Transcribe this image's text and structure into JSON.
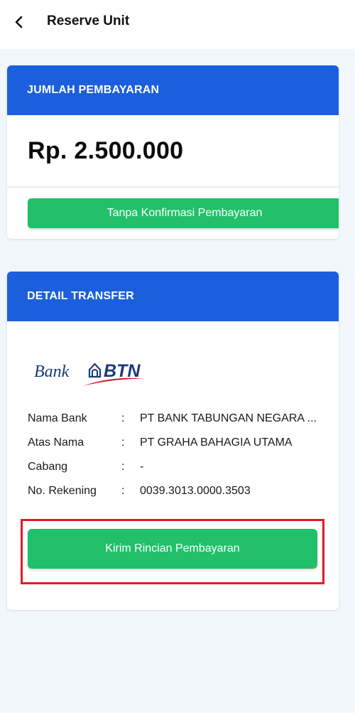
{
  "appbar": {
    "back_icon": "arrow-left-icon",
    "title": "Reserve Unit"
  },
  "payment_card": {
    "header": "JUMLAH PEMBAYARAN",
    "amount": "Rp. 2.500.000",
    "confirm_button": "Tanpa Konfirmasi Pembayaran"
  },
  "transfer_card": {
    "header": "DETAIL TRANSFER",
    "bank_logo": {
      "text_bank": "Bank",
      "text_btn": "BTN",
      "icon": "btn-house-logo-icon"
    },
    "rows": [
      {
        "label": "Nama Bank",
        "sep": ":",
        "value": "PT BANK TABUNGAN NEGARA ..."
      },
      {
        "label": "Atas Nama",
        "sep": ":",
        "value": "PT GRAHA BAHAGIA UTAMA"
      },
      {
        "label": "Cabang",
        "sep": ":",
        "value": "-"
      },
      {
        "label": "No. Rekening",
        "sep": ":",
        "value": "0039.3013.0000.3503"
      }
    ],
    "send_button": "Kirim Rincian Pembayaran"
  },
  "colors": {
    "primary_blue": "#1b5fdc",
    "button_green": "#22c06a",
    "highlight_red": "#e01b24",
    "background": "#f2f7fd"
  }
}
